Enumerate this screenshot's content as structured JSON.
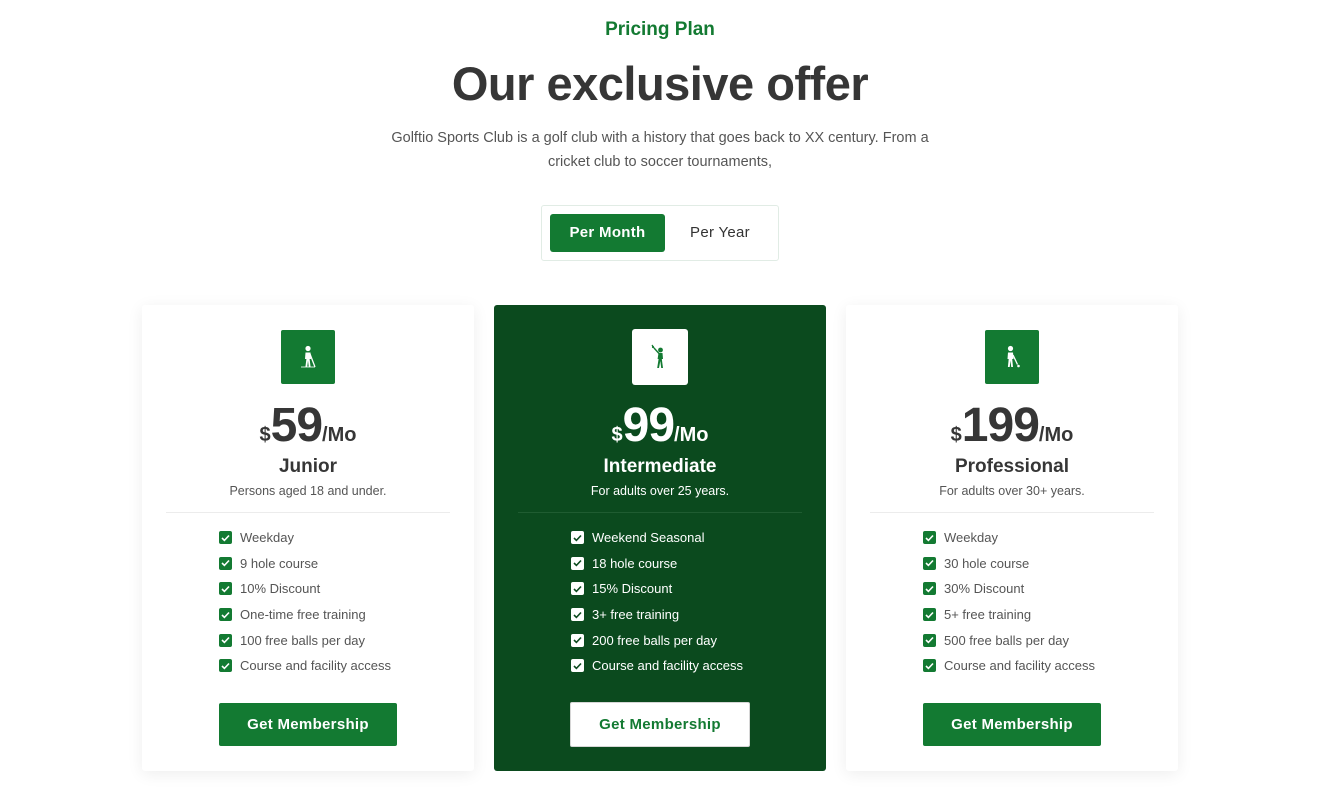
{
  "header": {
    "eyebrow": "Pricing Plan",
    "title": "Our exclusive offer",
    "intro": "Golftio Sports Club is a golf club with a history that goes back to XX century. From a cricket club to soccer tournaments,"
  },
  "billing_toggle": {
    "options": [
      "Per Month",
      "Per Year"
    ],
    "selected": "Per Month"
  },
  "plans": [
    {
      "currency": "$",
      "amount": "59",
      "period": "/Mo",
      "name": "Junior",
      "description": "Persons aged 18 and under.",
      "icon": "golfer-putting-icon",
      "featured": false,
      "features": [
        "Weekday",
        "9 hole course",
        "10% Discount",
        "One-time free training",
        "100 free balls per day",
        "Course and facility access"
      ],
      "cta": "Get Membership"
    },
    {
      "currency": "$",
      "amount": "99",
      "period": "/Mo",
      "name": "Intermediate",
      "description": "For adults over 25 years.",
      "icon": "golfer-swing-icon",
      "featured": true,
      "features": [
        "Weekend Seasonal",
        "18 hole course",
        "15% Discount",
        "3+ free training",
        "200 free balls per day",
        "Course and facility access"
      ],
      "cta": "Get Membership"
    },
    {
      "currency": "$",
      "amount": "199",
      "period": "/Mo",
      "name": "Professional",
      "description": "For adults over 30+ years.",
      "icon": "golfer-stance-icon",
      "featured": false,
      "features": [
        "Weekday",
        "30 hole course",
        "30% Discount",
        "5+ free training",
        "500 free balls per day",
        "Course and facility access"
      ],
      "cta": "Get Membership"
    }
  ],
  "colors": {
    "brand_green": "#137a32",
    "featured_bg": "#0b4a1e",
    "heading": "#363636",
    "body_text": "#555555"
  }
}
